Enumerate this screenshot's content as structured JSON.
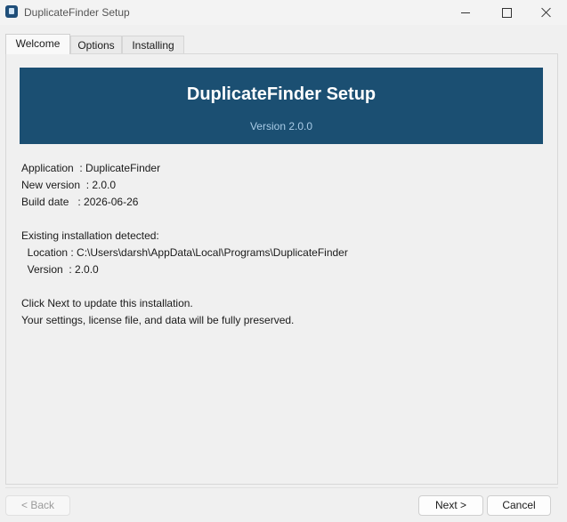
{
  "window": {
    "title": "DuplicateFinder Setup",
    "icon": "app-icon"
  },
  "tabs": [
    {
      "label": "Welcome",
      "active": true
    },
    {
      "label": "Options",
      "active": false
    },
    {
      "label": "Installing",
      "active": false
    }
  ],
  "banner": {
    "title": "DuplicateFinder Setup",
    "version": "Version 2.0.0",
    "background": "#1b4f72"
  },
  "info": {
    "application": "Application  : DuplicateFinder",
    "new_version": "New version  : 2.0.0",
    "build_date": "Build date   : 2026-06-26",
    "existing_heading": "Existing installation detected:",
    "location": "  Location : C:\\Users\\darsh\\AppData\\Local\\Programs\\DuplicateFinder",
    "version": "  Version  : 2.0.0",
    "instruction": "Click Next to update this installation.",
    "preserve_note": "Your settings, license file, and data will be fully preserved."
  },
  "buttons": {
    "back": "< Back",
    "next": "Next >",
    "cancel": "Cancel"
  }
}
